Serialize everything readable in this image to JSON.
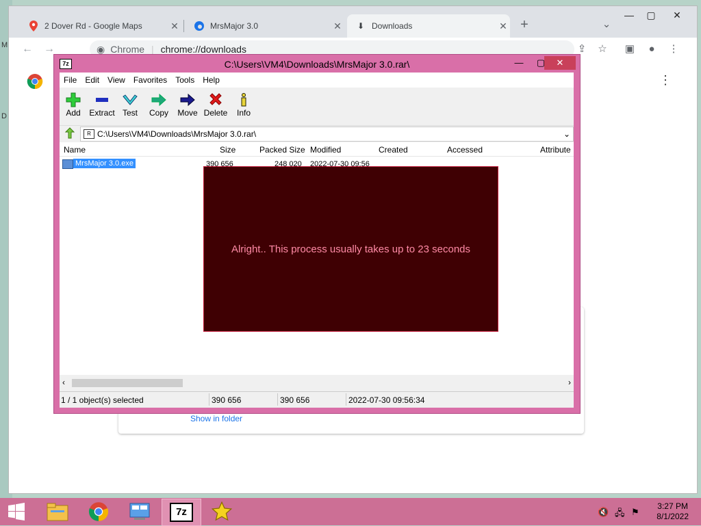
{
  "browser": {
    "tabs": [
      {
        "title": "2 Dover Rd - Google Maps",
        "icon": "google-maps-icon"
      },
      {
        "title": "MrsMajor 3.0",
        "icon": "edge-icon"
      },
      {
        "title": "Downloads",
        "icon": "download-icon"
      }
    ],
    "site_label": "Chrome",
    "url": "chrome://downloads",
    "show_in_folder": "Show in folder"
  },
  "sevenzip": {
    "title": "C:\\Users\\VM4\\Downloads\\MrsMajor 3.0.rar\\",
    "logo": "7z",
    "menu": [
      "File",
      "Edit",
      "View",
      "Favorites",
      "Tools",
      "Help"
    ],
    "tools": [
      "Add",
      "Extract",
      "Test",
      "Copy",
      "Move",
      "Delete",
      "Info"
    ],
    "address": "C:\\Users\\VM4\\Downloads\\MrsMajor 3.0.rar\\",
    "columns": [
      "Name",
      "Size",
      "Packed Size",
      "Modified",
      "Created",
      "Accessed",
      "Attribute"
    ],
    "file": {
      "name": "MrsMajor 3.0.exe",
      "size": "390 656",
      "packed": "248 020",
      "modified": "2022-07-30 09:56"
    },
    "status": {
      "selected": "1 / 1 object(s) selected",
      "size": "390 656",
      "packed": "390 656",
      "modified": "2022-07-30 09:56:34"
    }
  },
  "overlay": {
    "message": "Alright.. This process usually takes up to 23 seconds",
    "bg": "#3f0003",
    "text_color": "#ff8aa6"
  },
  "taskbar": {
    "time": "3:27 PM",
    "date": "8/1/2022",
    "items": [
      "start-icon",
      "file-explorer-icon",
      "chrome-icon",
      "control-panel-icon",
      "7zip-icon",
      "star-icon"
    ]
  }
}
